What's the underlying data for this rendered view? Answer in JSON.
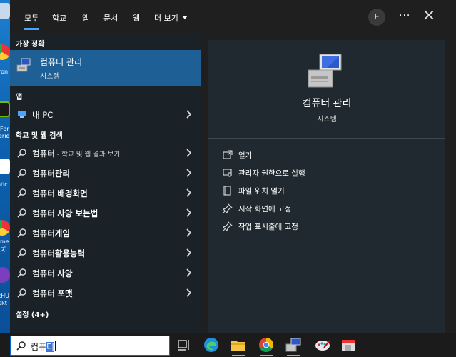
{
  "desktop": {
    "labels": [
      "ron",
      "For",
      "erie",
      "otic",
      "me",
      "ズ",
      "tHU",
      "skt"
    ]
  },
  "tabs": [
    {
      "label": "모두",
      "active": true
    },
    {
      "label": "학교"
    },
    {
      "label": "앱"
    },
    {
      "label": "문서"
    },
    {
      "label": "웹"
    },
    {
      "label": "더 보기"
    }
  ],
  "account": {
    "initial": "E"
  },
  "more_label": "···",
  "best_match": {
    "section": "가장 정확",
    "title": "컴퓨터 관리",
    "subtitle": "시스템"
  },
  "apps": {
    "section": "앱",
    "items": [
      {
        "label": "내 PC"
      }
    ]
  },
  "web": {
    "section": "학교 및 웹 검색",
    "items": [
      {
        "prefix": "컴퓨터",
        "suffix": " - 학교 및 웹 결과 보기"
      },
      {
        "prefix": "컴퓨터",
        "bold": "관리"
      },
      {
        "prefix": "컴퓨터 ",
        "bold": "배경화면"
      },
      {
        "prefix": "컴퓨터 ",
        "bold": "사양 보는법"
      },
      {
        "prefix": "컴퓨터",
        "bold": "게임"
      },
      {
        "prefix": "컴퓨터",
        "bold": "활용능력"
      },
      {
        "prefix": "컴퓨터 ",
        "bold": "사양"
      },
      {
        "prefix": "컴퓨터 ",
        "bold": "포맷"
      }
    ]
  },
  "settings": {
    "section": "설정 (4+)"
  },
  "detail": {
    "title": "컴퓨터 관리",
    "subtitle": "시스템",
    "actions": [
      {
        "label": "열기",
        "icon": "open-icon"
      },
      {
        "label": "관리자 권한으로 실행",
        "icon": "shield-run-icon"
      },
      {
        "label": "파일 위치 열기",
        "icon": "file-location-icon"
      },
      {
        "label": "시작 화면에 고정",
        "icon": "pin-icon"
      },
      {
        "label": "작업 표시줄에 고정",
        "icon": "pin-taskbar-icon"
      }
    ]
  },
  "search": {
    "typed": "컴퓨",
    "selected": "터"
  },
  "taskbar": {
    "icons": [
      "task-view-icon",
      "edge-icon",
      "file-explorer-icon",
      "chrome-icon",
      "computer-management-icon",
      "paint-icon",
      "store-icon"
    ]
  },
  "colors": {
    "panel": "#1f1f1f",
    "left_pane": "#1b2227",
    "right_pane": "#1f292f",
    "best_highlight": "#1e5f95",
    "accent": "#4aa3ff",
    "taskbar": "#1b1b1b"
  }
}
